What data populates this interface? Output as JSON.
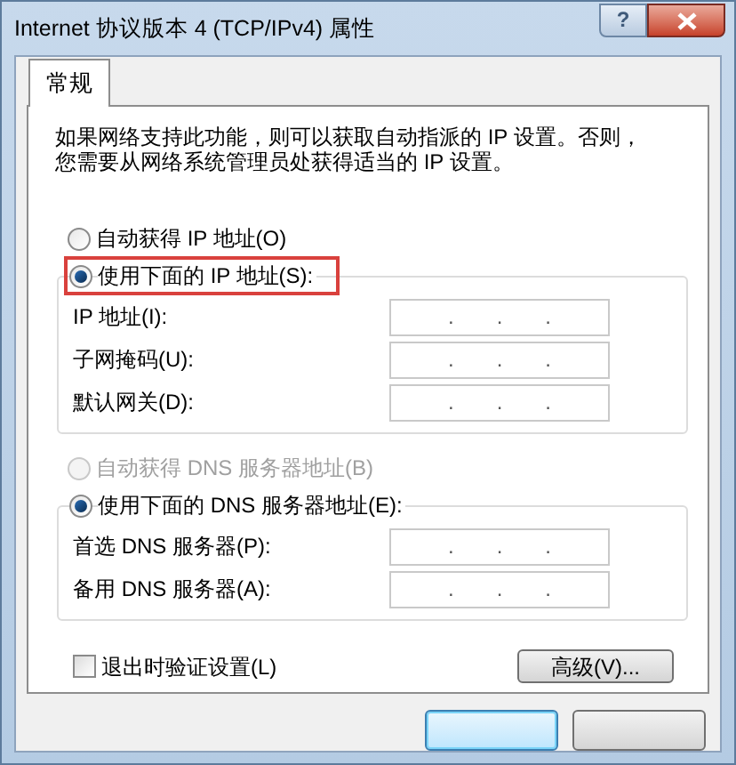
{
  "window": {
    "title": "Internet 协议版本 4 (TCP/IPv4) 属性",
    "help_label": "?"
  },
  "tabs": [
    {
      "label": "常规",
      "selected": true
    }
  ],
  "description": [
    "如果网络支持此功能，则可以获取自动指派的 IP 设置。否则，",
    "您需要从网络系统管理员处获得适当的 IP 设置。"
  ],
  "ip_section": {
    "options": [
      {
        "label": "自动获得 IP 地址(O)",
        "selected": false,
        "disabled": false,
        "highlighted": false
      },
      {
        "label": "使用下面的 IP 地址(S):",
        "selected": true,
        "disabled": false,
        "highlighted": true
      }
    ],
    "fields": [
      {
        "label": "IP 地址(I):",
        "separators": [
          ".",
          ".",
          "."
        ]
      },
      {
        "label": "子网掩码(U):",
        "separators": [
          ".",
          ".",
          "."
        ]
      },
      {
        "label": "默认网关(D):",
        "separators": [
          ".",
          ".",
          "."
        ]
      }
    ]
  },
  "dns_section": {
    "options": [
      {
        "label": "自动获得 DNS 服务器地址(B)",
        "selected": false,
        "disabled": true,
        "highlighted": false
      },
      {
        "label": "使用下面的 DNS 服务器地址(E):",
        "selected": true,
        "disabled": false,
        "highlighted": false
      }
    ],
    "fields": [
      {
        "label": "首选 DNS 服务器(P):",
        "separators": [
          ".",
          ".",
          "."
        ]
      },
      {
        "label": "备用 DNS 服务器(A):",
        "separators": [
          ".",
          ".",
          "."
        ]
      }
    ]
  },
  "validate_checkbox": {
    "label": "退出时验证设置(L)",
    "checked": false
  },
  "advanced_button": {
    "label": "高级(V)..."
  }
}
